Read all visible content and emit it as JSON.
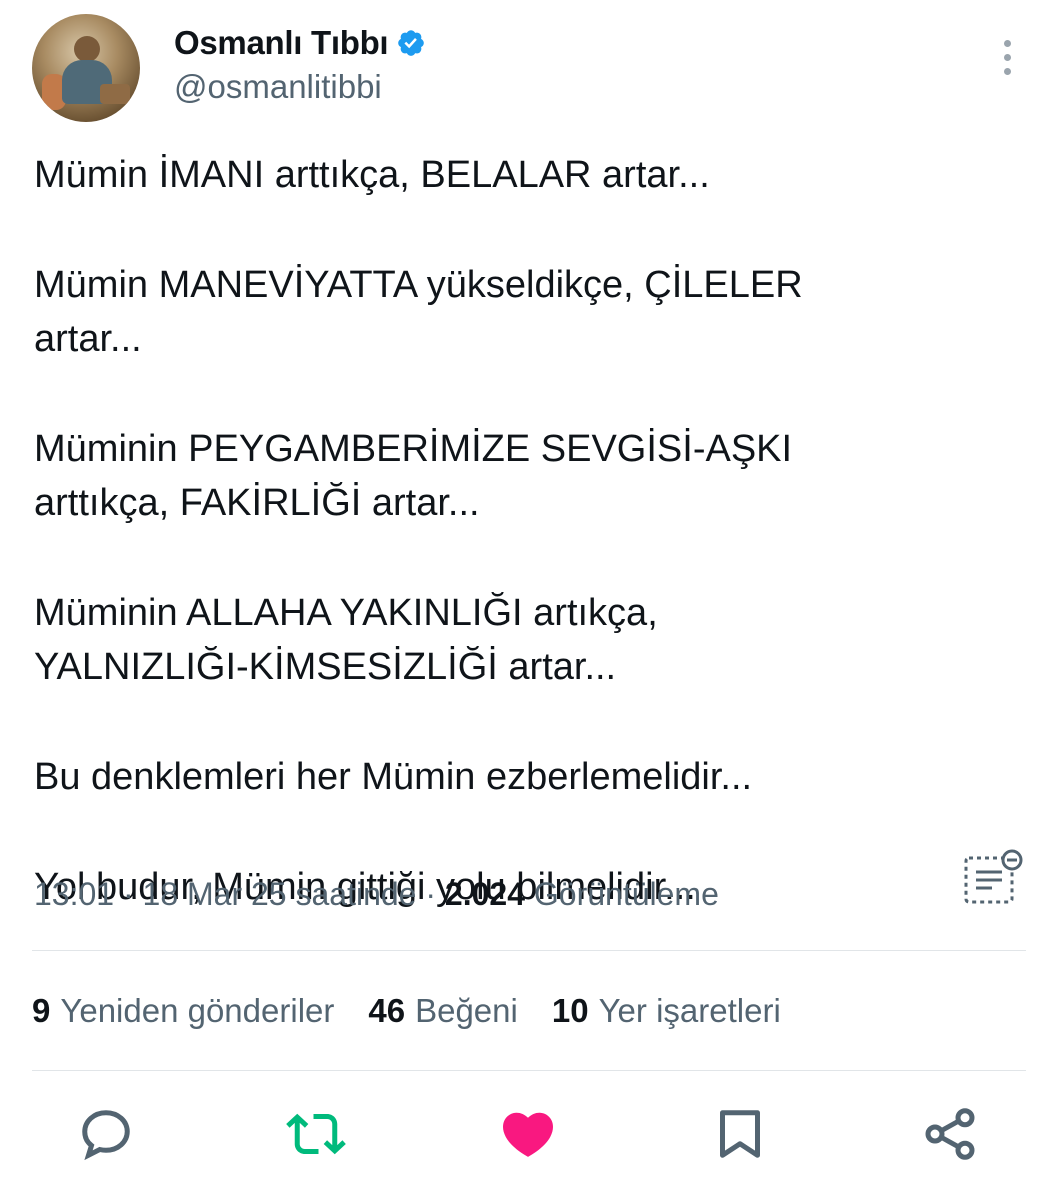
{
  "author": {
    "name": "Osmanlı Tıbbı",
    "handle": "@osmanlitibbi",
    "verified": true,
    "verified_color": "#1d9bf0"
  },
  "tweet": {
    "paragraphs": [
      "Mümin İMANI arttıkça, BELALAR artar...",
      "Mümin MANEVİYATTA yükseldikçe, ÇİLELER artar...",
      "Müminin PEYGAMBERİMİZE SEVGİSİ-AŞKI arttıkça, FAKİRLİĞİ artar...",
      "Müminin ALLAHA YAKINLIĞI artıkça, YALNIZLIĞI-KİMSESİZLİĞİ artar...",
      "Bu denklemleri her Mümin ezberlemelidir...",
      "Yol budur, Mümin gittiği yolu bilmelidir..."
    ]
  },
  "meta": {
    "time": "13:01",
    "date": "18 Mar 25 saatinde",
    "separator": "·",
    "views_count": "2.024",
    "views_label": "Görüntüleme"
  },
  "stats": {
    "reposts_count": "9",
    "reposts_label": "Yeniden gönderiler",
    "likes_count": "46",
    "likes_label": "Beğeni",
    "bookmarks_count": "10",
    "bookmarks_label": "Yer işaretleri"
  },
  "actions": {
    "icons": [
      "reply-icon",
      "retweet-icon",
      "like-icon",
      "bookmark-icon",
      "share-icon"
    ],
    "retweet_color": "#00ba7c",
    "like_color": "#f91880",
    "default_color": "#536471"
  }
}
